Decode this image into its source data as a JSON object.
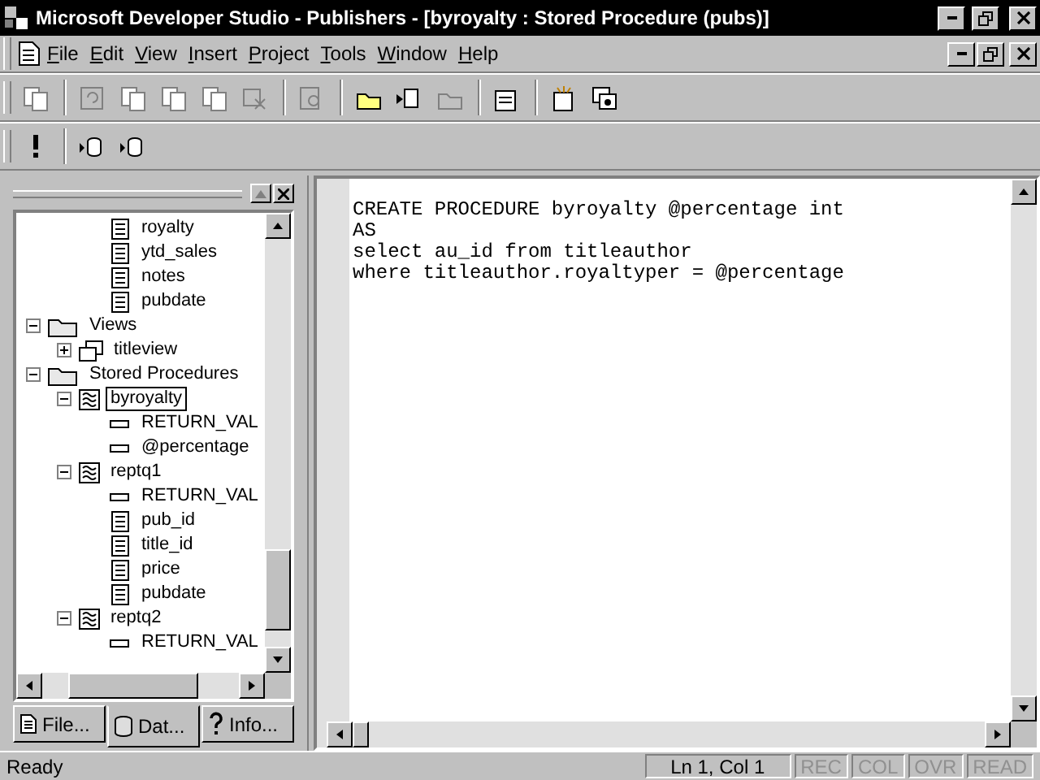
{
  "window": {
    "title": "Microsoft Developer Studio - Publishers - [byroyalty : Stored Procedure (pubs)]"
  },
  "menu": [
    "File",
    "Edit",
    "View",
    "Insert",
    "Project",
    "Tools",
    "Window",
    "Help"
  ],
  "toolbars": [
    [
      {
        "disabled": true
      },
      {
        "disabled": true
      },
      {
        "disabled": true
      },
      {
        "disabled": true
      },
      {
        "disabled": true
      },
      {
        "disabled": true
      },
      {
        "disabled": true
      },
      {
        "disabled": false
      },
      {
        "disabled": false
      },
      {
        "disabled": true
      },
      {
        "disabled": false
      },
      {
        "disabled": false
      },
      {
        "disabled": false
      }
    ],
    [
      {
        "disabled": false
      },
      {
        "disabled": false
      },
      {
        "disabled": false
      }
    ]
  ],
  "tree": {
    "continued_items": [
      {
        "label": "royalty",
        "kind": "column"
      },
      {
        "label": "ytd_sales",
        "kind": "column"
      },
      {
        "label": "notes",
        "kind": "column"
      },
      {
        "label": "pubdate",
        "kind": "column"
      }
    ],
    "items": [
      {
        "label": "Views",
        "kind": "folder",
        "expanded": true,
        "selected": false,
        "children": [
          {
            "label": "titleview",
            "kind": "view",
            "expanded": false,
            "selected": false
          }
        ]
      },
      {
        "label": "Stored Procedures",
        "kind": "folder",
        "expanded": true,
        "selected": false,
        "children": [
          {
            "label": "byroyalty",
            "kind": "procedure",
            "expanded": true,
            "selected": true,
            "children": [
              {
                "label": "RETURN_VAL",
                "kind": "parameter"
              },
              {
                "label": "@percentage",
                "kind": "parameter"
              }
            ]
          },
          {
            "label": "reptq1",
            "kind": "procedure",
            "expanded": true,
            "selected": false,
            "children": [
              {
                "label": "RETURN_VAL",
                "kind": "parameter"
              },
              {
                "label": "pub_id",
                "kind": "column"
              },
              {
                "label": "title_id",
                "kind": "column"
              },
              {
                "label": "price",
                "kind": "column"
              },
              {
                "label": "pubdate",
                "kind": "column"
              }
            ]
          },
          {
            "label": "reptq2",
            "kind": "procedure",
            "expanded": true,
            "selected": false,
            "children": [
              {
                "label": "RETURN_VAL",
                "kind": "parameter"
              }
            ]
          }
        ]
      }
    ]
  },
  "pane_tabs": [
    {
      "label": "File...",
      "selected": false
    },
    {
      "label": "Dat...",
      "selected": true
    },
    {
      "label": "Info...",
      "selected": false
    }
  ],
  "editor": {
    "lines": [
      "CREATE PROCEDURE byroyalty @percentage int",
      "AS",
      "select au_id from titleauthor",
      "where titleauthor.royaltyper = @percentage"
    ]
  },
  "status_bar": {
    "message": "Ready",
    "position": "Ln 1, Col 1",
    "indicators": [
      {
        "label": "REC",
        "disabled": true
      },
      {
        "label": "COL",
        "disabled": true
      },
      {
        "label": "OVR",
        "disabled": true
      },
      {
        "label": "READ",
        "disabled": true
      }
    ]
  }
}
